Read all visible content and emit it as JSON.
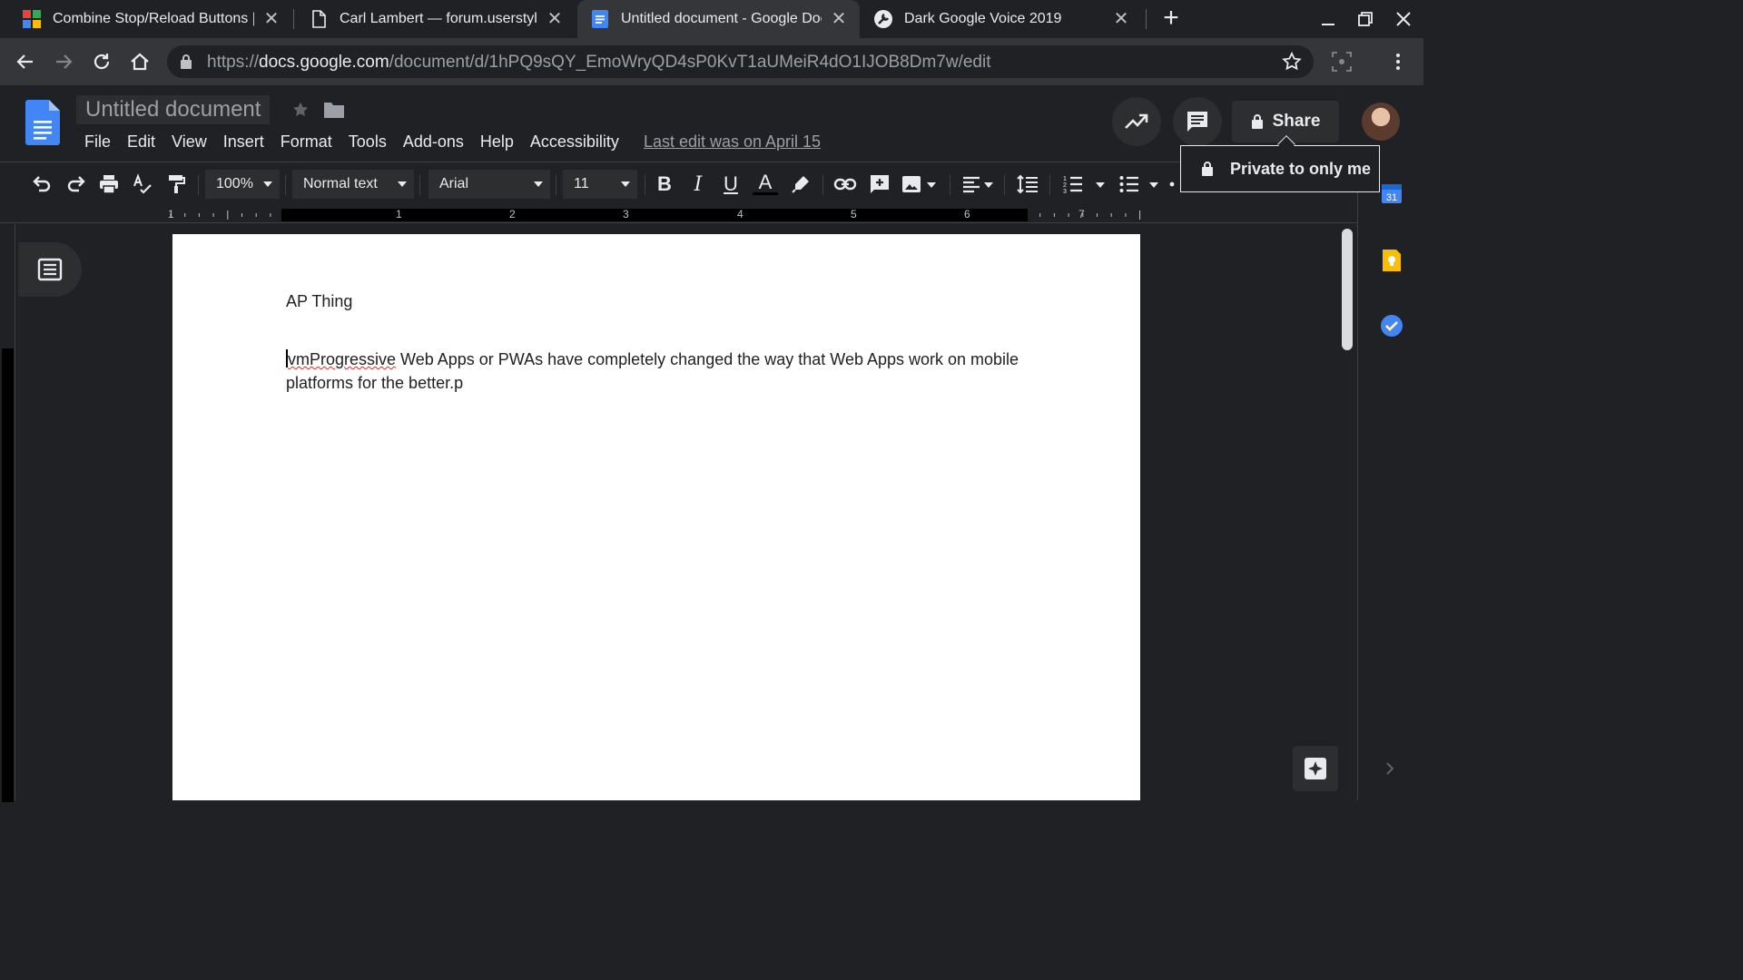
{
  "browser": {
    "tabs": [
      {
        "title": "Combine Stop/Reload Buttons | U",
        "favicon": "windows-grid-icon"
      },
      {
        "title": "Carl Lambert — forum.userstyles",
        "favicon": "page-icon"
      },
      {
        "title": "Untitled document - Google Docs",
        "favicon": "google-docs-icon",
        "active": true
      },
      {
        "title": "Dark Google Voice 2019",
        "favicon": "userstyles-wrench-icon"
      }
    ],
    "url_scheme": "https://",
    "url_host": "docs.google.com",
    "url_path": "/document/d/1hPQ9sQY_EmoWryQD4sP0KvT1aUMeiR4dO1IJOB8Dm7w/edit"
  },
  "docs": {
    "title": "Untitled document",
    "menu": [
      "File",
      "Edit",
      "View",
      "Insert",
      "Format",
      "Tools",
      "Add-ons",
      "Help",
      "Accessibility"
    ],
    "last_edit": "Last edit was on April 15",
    "share_label": "Share",
    "tooltip": "Private to only me"
  },
  "toolbar": {
    "zoom": "100%",
    "style": "Normal text",
    "font": "Arial",
    "font_size": "11",
    "bold": "B",
    "italic": "I",
    "underline": "U",
    "text_color": "A"
  },
  "ruler": {
    "numbers": [
      "1",
      "1",
      "2",
      "3",
      "4",
      "5",
      "6",
      "7"
    ]
  },
  "document": {
    "heading": "AP Thing",
    "para_misspelled": "vmProgressive",
    "para_rest": " Web Apps or PWAs have completely changed the way that Web Apps work on mobile platforms for the better.p"
  },
  "side_panel": {
    "calendar_day": "31"
  },
  "colors": {
    "docs_blue": "#4285f4",
    "keep_yellow": "#fbbc04",
    "tasks_blue": "#4285f4",
    "spell_red": "#d93025"
  }
}
